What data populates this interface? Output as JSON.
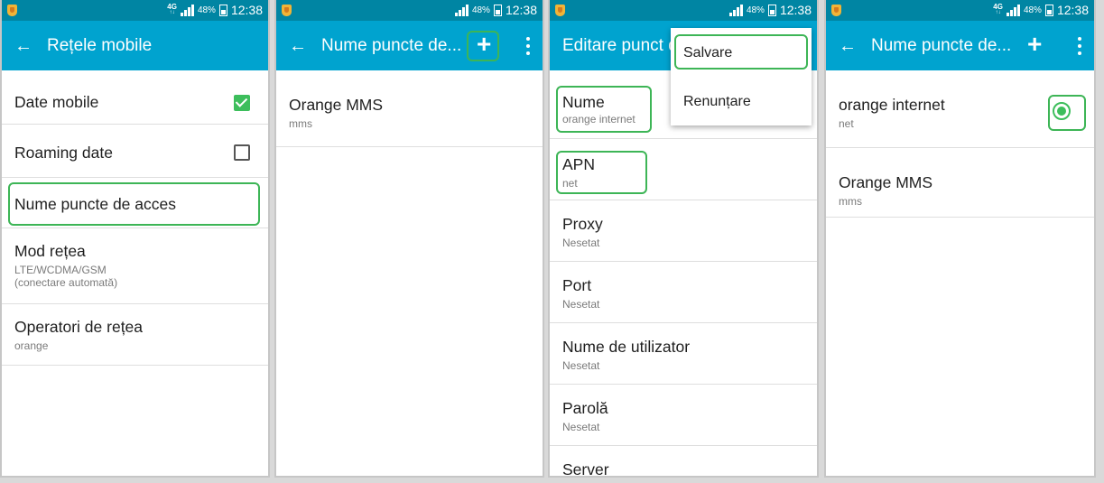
{
  "status": {
    "net_type": "4G",
    "net_sub": "↑↓",
    "battery_pct": "48%",
    "time": "12:38"
  },
  "screen1": {
    "title": "Rețele mobile",
    "items": [
      {
        "title": "Date mobile"
      },
      {
        "title": "Roaming date"
      },
      {
        "title": "Nume puncte de acces"
      },
      {
        "title": "Mod rețea",
        "sub": "LTE/WCDMA/GSM",
        "sub2": "(conectare automată)"
      },
      {
        "title": "Operatori de rețea",
        "sub": "orange"
      }
    ]
  },
  "screen2": {
    "title": "Nume puncte de...",
    "items": [
      {
        "title": "Orange MMS",
        "sub": "mms"
      }
    ]
  },
  "screen3": {
    "title": "Editare punct d",
    "menu": {
      "save": "Salvare",
      "cancel": "Renunțare"
    },
    "fields": [
      {
        "title": "Nume",
        "sub": "orange internet"
      },
      {
        "title": "APN",
        "sub": "net"
      },
      {
        "title": "Proxy",
        "sub": "Nesetat"
      },
      {
        "title": "Port",
        "sub": "Nesetat"
      },
      {
        "title": "Nume de utilizator",
        "sub": "Nesetat"
      },
      {
        "title": "Parolă",
        "sub": "Nesetat"
      },
      {
        "title": "Server"
      }
    ]
  },
  "screen4": {
    "title": "Nume puncte de...",
    "items": [
      {
        "title": "orange internet",
        "sub": "net"
      },
      {
        "title": "Orange MMS",
        "sub": "mms"
      }
    ]
  },
  "colors": {
    "statusbar": "#0085a3",
    "appbar": "#00a3cf",
    "highlight": "#3db556",
    "check": "#3dbe5c"
  }
}
